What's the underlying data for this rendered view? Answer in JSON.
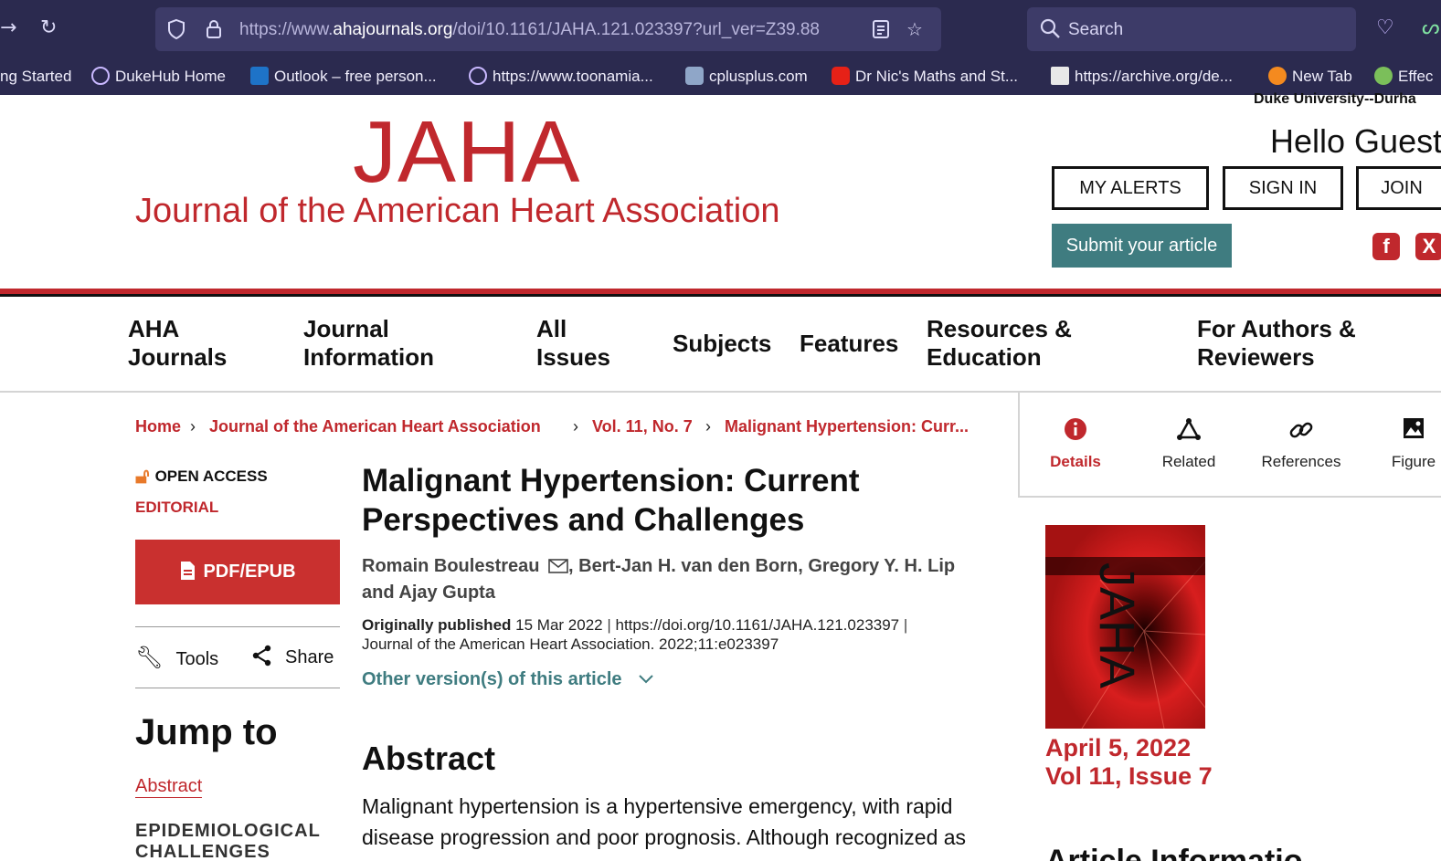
{
  "browser": {
    "url_prefix": "https://www.",
    "url_domain": "ahajournals.org",
    "url_suffix": "/doi/10.1161/JAHA.121.023397?url_ver=Z39.88",
    "search_placeholder": "Search",
    "bookmarks": [
      {
        "label": "ng Started",
        "icon": "firefox-icon"
      },
      {
        "label": "DukeHub Home",
        "icon": "globe-icon"
      },
      {
        "label": "Outlook – free person...",
        "icon": "outlook-icon"
      },
      {
        "label": "https://www.toonamia...",
        "icon": "globe-icon"
      },
      {
        "label": "cplusplus.com",
        "icon": "cplusplus-icon"
      },
      {
        "label": "Dr Nic's Maths and St...",
        "icon": "youtube-icon"
      },
      {
        "label": "https://archive.org/de...",
        "icon": "archive-icon"
      },
      {
        "label": "New Tab",
        "icon": "firefox-icon"
      },
      {
        "label": "Effec",
        "icon": "extension-icon"
      }
    ]
  },
  "header": {
    "institution": "Duke University--Durha",
    "logo_main": "JAHA",
    "logo_sub": "Journal of the American Heart Association",
    "hello": "Hello Guest",
    "my_alerts": "MY ALERTS",
    "sign_in": "SIGN IN",
    "join": "JOIN",
    "submit": "Submit your article"
  },
  "nav": {
    "items": [
      {
        "line1": "AHA",
        "line2": "Journals"
      },
      {
        "line1": "Journal",
        "line2": "Information"
      },
      {
        "line1": "All",
        "line2": "Issues"
      },
      {
        "line1": "Subjects",
        "line2": ""
      },
      {
        "line1": "Features",
        "line2": ""
      },
      {
        "line1": "Resources &",
        "line2": "Education"
      },
      {
        "line1": "For Authors &",
        "line2": "Reviewers"
      }
    ]
  },
  "breadcrumb": [
    "Home",
    "Journal of the American Heart Association",
    "Vol. 11, No. 7",
    "Malignant Hypertension: Curr..."
  ],
  "panel": {
    "tabs": [
      {
        "label": "Details",
        "icon": "info-icon"
      },
      {
        "label": "Related",
        "icon": "network-icon"
      },
      {
        "label": "References",
        "icon": "link-icon"
      },
      {
        "label": "Figure",
        "icon": "image-icon"
      }
    ],
    "cover_date": "April 5, 2022",
    "cover_issue": "Vol 11, Issue 7",
    "article_info": "Article Informatio"
  },
  "left": {
    "open_access": "OPEN ACCESS",
    "type": "EDITORIAL",
    "pdf": "PDF/EPUB",
    "tools": "Tools",
    "share": "Share",
    "jump_to": "Jump to",
    "abstract_link": "Abstract",
    "section": "EPIDEMIOLOGICAL CHALLENGES"
  },
  "article": {
    "title": "Malignant Hypertension: Current Perspectives and Challenges",
    "author1": "Romain Boulestreau",
    "authors_rest": ", Bert-Jan H. van den Born, Gregory Y. H. Lip and Ajay Gupta",
    "published_label": "Originally published",
    "published_date": "15 Mar 2022",
    "doi": "https://doi.org/10.1161/JAHA.121.023397",
    "citation": "Journal of the American Heart Association. 2022;11:e023397",
    "other_versions": "Other version(s) of this article",
    "abstract_heading": "Abstract",
    "abstract_text": "Malignant hypertension is a hypertensive emergency, with rapid disease progression and poor prognosis. Although recognized as"
  }
}
